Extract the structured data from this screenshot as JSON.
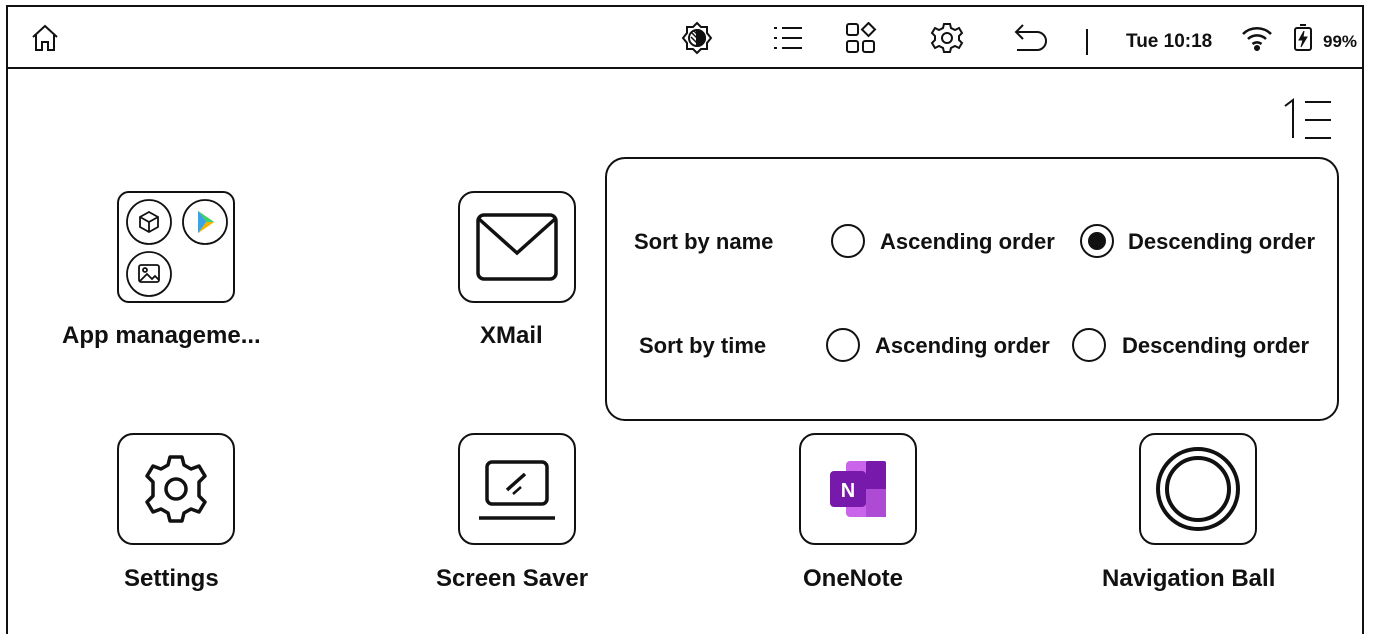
{
  "status_bar": {
    "time": "Tue 10:18",
    "battery_percent": "99%",
    "icons": [
      "home-icon",
      "contrast-icon",
      "list-icon",
      "apps-icon",
      "settings-icon",
      "back-icon",
      "wifi-icon",
      "battery-icon"
    ]
  },
  "toolbar": {
    "sort_icon": "sort-icon"
  },
  "apps": [
    {
      "label": "App manageme...",
      "icon": "app-management-icon"
    },
    {
      "label": "XMail",
      "icon": "mail-icon"
    },
    {
      "label": "Settings",
      "icon": "gear-icon"
    },
    {
      "label": "Screen Saver",
      "icon": "screen-saver-icon"
    },
    {
      "label": "OneNote",
      "icon": "onenote-icon",
      "icon_letter": "N",
      "color": "#7719aa"
    },
    {
      "label": "Navigation Ball",
      "icon": "navigation-ball-icon"
    }
  ],
  "sort_panel": {
    "by_name": {
      "label": "Sort by name",
      "ascending": "Ascending order",
      "descending": "Descending order",
      "selected": "descending"
    },
    "by_time": {
      "label": "Sort by time",
      "ascending": "Ascending order",
      "descending": "Descending order",
      "selected": "none"
    }
  }
}
